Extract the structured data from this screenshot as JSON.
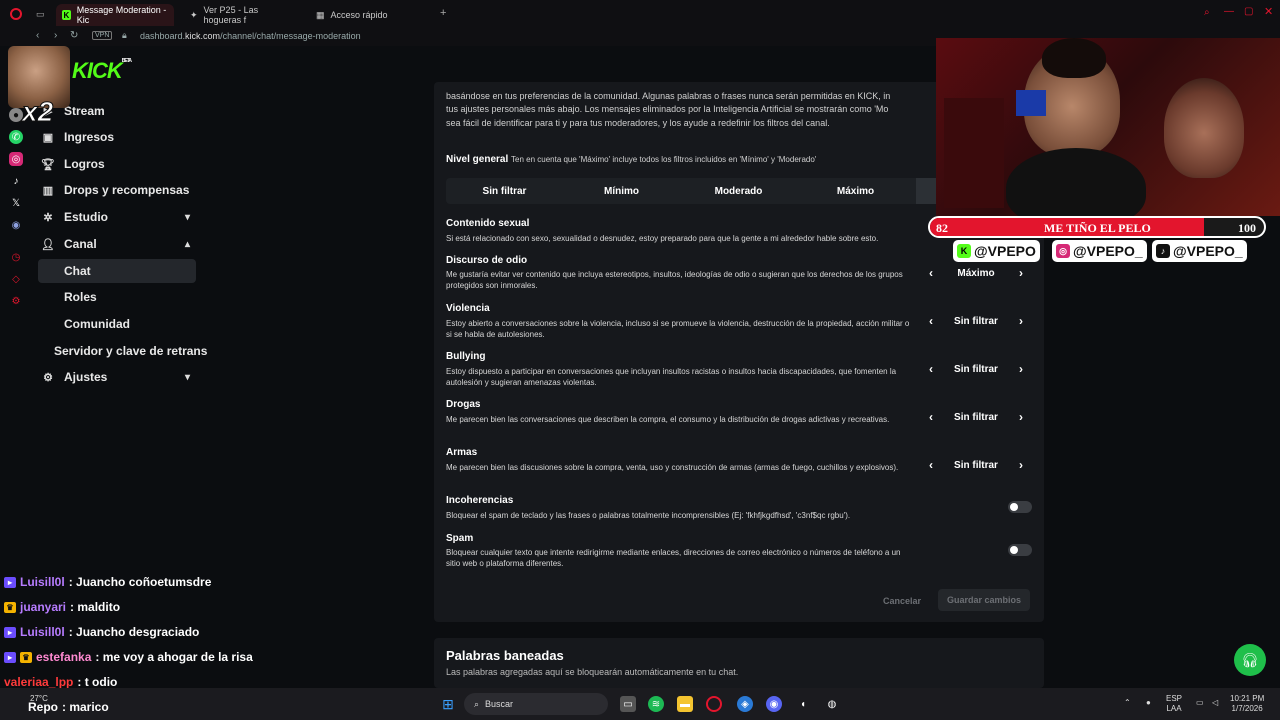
{
  "browser": {
    "tabs": [
      {
        "label": "Message Moderation - Kic",
        "active": true
      },
      {
        "label": "Ver P25 - Las hogueras f",
        "active": false
      },
      {
        "label": "Acceso rápido",
        "active": false
      }
    ],
    "vpn_label": "VPN",
    "url_prefix": "dashboard.",
    "url_domain": "kick.com",
    "url_path": "/channel/chat/message-moderation"
  },
  "overlay": {
    "multiplier": "x2",
    "logo_text": "KICK",
    "logo_beta": "BETA"
  },
  "sidebar": {
    "items": [
      {
        "label": "Stream",
        "icon": "stream-icon"
      },
      {
        "label": "Ingresos",
        "icon": "revenue-icon"
      },
      {
        "label": "Logros",
        "icon": "trophy-icon"
      },
      {
        "label": "Drops y recompensas",
        "icon": "drops-icon"
      },
      {
        "label": "Estudio",
        "icon": "studio-icon"
      },
      {
        "label": "Canal",
        "icon": "channel-icon"
      },
      {
        "label": "Chat"
      },
      {
        "label": "Roles"
      },
      {
        "label": "Comunidad"
      },
      {
        "label": "Servidor y clave de retrans"
      },
      {
        "label": "Ajustes",
        "icon": "gear-icon"
      }
    ]
  },
  "moderation": {
    "intro_line1": "basándose en tus preferencias de la comunidad. Algunas palabras o frases nunca serán permitidas en KICK, in",
    "intro_line2": "tus ajustes personales más abajo. Los mensajes eliminados por la Inteligencia Artificial se mostrarán como 'Mo",
    "intro_line3": "sea fácil de identificar para ti y para tus moderadores, y los ayude a redefinir los filtros del canal.",
    "level_title": "Nivel general",
    "level_note": "Ten en cuenta que 'Máximo' incluye todos los filtros incluidos en 'Mínimo' y 'Moderado'",
    "levels": [
      "Sin filtrar",
      "Mínimo",
      "Moderado",
      "Máximo"
    ],
    "categories": [
      {
        "title": "Contenido sexual",
        "desc": "Si está relacionado con sexo, sexualidad o desnudez, estoy preparado para que la gente a mi alrededor hable sobre esto.",
        "value": ""
      },
      {
        "title": "Discurso de odio",
        "desc": "Me gustaría evitar ver contenido que incluya estereotipos, insultos, ideologías de odio o sugieran que los derechos de los grupos protegidos son inmorales.",
        "value": "Máximo"
      },
      {
        "title": "Violencia",
        "desc": "Estoy abierto a conversaciones sobre la violencia, incluso si se promueve la violencia, destrucción de la propiedad, acción militar o si se habla de autolesiones.",
        "value": "Sin filtrar"
      },
      {
        "title": "Bullying",
        "desc": "Estoy dispuesto a participar en conversaciones que incluyan insultos racistas o insultos hacia discapacidades, que fomenten la autolesión y sugieran amenazas violentas.",
        "value": "Sin filtrar"
      },
      {
        "title": "Drogas",
        "desc": "Me parecen bien las conversaciones que describen la compra, el consumo y la distribución de drogas adictivas y recreativas.",
        "value": "Sin filtrar"
      },
      {
        "title": "Armas",
        "desc": "Me parecen bien las discusiones sobre la compra, venta, uso y construcción de armas (armas de fuego, cuchillos y explosivos).",
        "value": "Sin filtrar"
      }
    ],
    "toggles": [
      {
        "title": "Incoherencias",
        "desc": "Bloquear el spam de teclado y las frases o palabras totalmente incomprensibles (Ej: 'fkhfjkgdfhsd', 'c3nf$qc rgbu').",
        "on": false
      },
      {
        "title": "Spam",
        "desc": "Bloquear cualquier texto que intente redirigirme mediante enlaces, direcciones de correo electrónico o números de teléfono a un sitio web o plataforma diferentes.",
        "on": false
      }
    ],
    "cancel_label": "Cancelar",
    "save_label": "Guardar cambios"
  },
  "banned_words": {
    "title": "Palabras baneadas",
    "desc": "Las palabras agregadas aquí se bloquearán automáticamente en tu chat."
  },
  "stream_overlay": {
    "progress_left": "82",
    "progress_label": "ME TIÑO EL PELO",
    "progress_right": "100",
    "progress_fraction": 0.82,
    "socials": [
      {
        "handle": "@VPEPO",
        "icon": "kick-icon",
        "color": "#53fc18"
      },
      {
        "handle": "@VPEPO_",
        "icon": "instagram-icon",
        "color": "#d62976"
      },
      {
        "handle": "@VPEPO_",
        "icon": "tiktok-icon",
        "color": "#111111"
      }
    ]
  },
  "chat": [
    {
      "user": "Luisill0l",
      "message": ": Juancho coñoetumsdre",
      "color": "#b77cff",
      "badge": "#6b4dff"
    },
    {
      "user": "juanyari",
      "message": ": maldito",
      "color": "#b77cff",
      "badge": "#f5b300"
    },
    {
      "user": "Luisill0l",
      "message": ": Juancho desgraciado",
      "color": "#b77cff",
      "badge": "#6b4dff"
    },
    {
      "user": "estefanka",
      "message": ": me voy a ahogar de la risa",
      "color": "#ff8ad1",
      "badge": "#f5b300"
    },
    {
      "user": "valeriaa_lpp",
      "message": ": t odio",
      "color": "#ff3b3b",
      "badge": ""
    },
    {
      "user": "Repo",
      "message": ": marico",
      "color": "#ffffff",
      "badge": ""
    }
  ],
  "taskbar": {
    "weather": "27°C",
    "search_placeholder": "Buscar",
    "lang_line1": "ESP",
    "lang_line2": "LAA",
    "time": "10:21 PM",
    "date": "1/7/2026"
  }
}
